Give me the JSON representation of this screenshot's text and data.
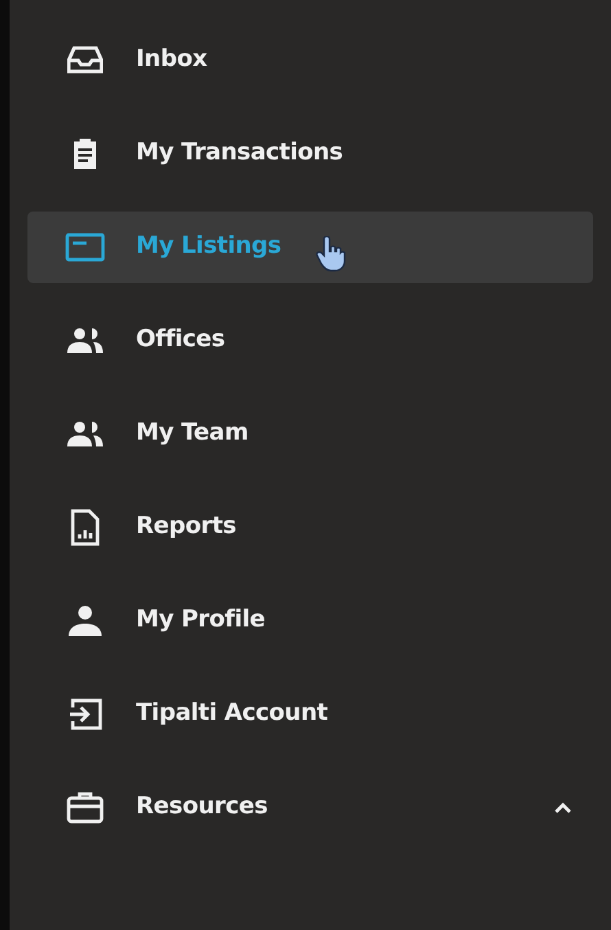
{
  "sidebar": {
    "items": [
      {
        "label": "Inbox",
        "selected": false
      },
      {
        "label": "My Transactions",
        "selected": false
      },
      {
        "label": "My Listings",
        "selected": true
      },
      {
        "label": "Offices",
        "selected": false
      },
      {
        "label": "My Team",
        "selected": false
      },
      {
        "label": "Reports",
        "selected": false
      },
      {
        "label": "My Profile",
        "selected": false
      },
      {
        "label": "Tipalti Account",
        "selected": false
      },
      {
        "label": "Resources",
        "selected": false,
        "expanded": true
      }
    ]
  }
}
